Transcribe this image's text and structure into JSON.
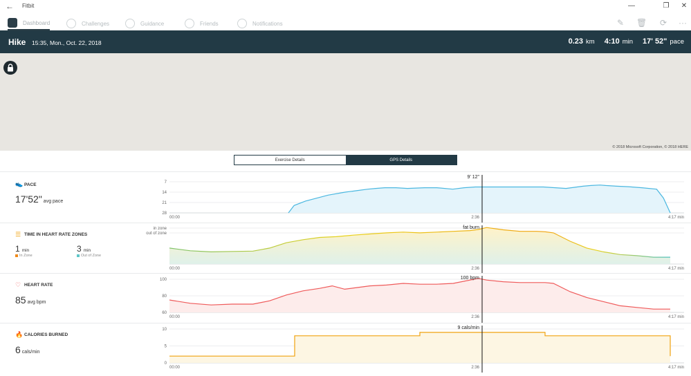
{
  "window": {
    "app_name": "Fitbit",
    "back_glyph": "←",
    "minimize_glyph": "—",
    "restore_glyph": "❐",
    "close_glyph": "✕"
  },
  "nav": {
    "items": [
      {
        "label": "Dashboard",
        "icon": "dashboard-icon",
        "active": true
      },
      {
        "label": "Challenges",
        "icon": "star-badge-icon",
        "active": false
      },
      {
        "label": "Guidance",
        "icon": "compass-icon",
        "active": false
      },
      {
        "label": "Friends",
        "icon": "friends-icon",
        "active": false
      },
      {
        "label": "Notifications",
        "icon": "chat-bubble-icon",
        "active": false
      }
    ],
    "tools": {
      "edit": "✎",
      "delete": "🗑",
      "sync": "⟳",
      "more": "···"
    }
  },
  "header": {
    "activity": "Hike",
    "datetime": "15:35, Mon., Oct. 22, 2018",
    "distance_value": "0.23",
    "distance_unit": "km",
    "duration_value": "4:10",
    "duration_unit": "min",
    "pace_value": "17' 52\"",
    "pace_unit": "pace"
  },
  "map": {
    "copyright": "© 2018 Microsoft Corporation, © 2018 HERE",
    "lock_icon": "lock-icon"
  },
  "tabs": {
    "exercise": "Exercise Details",
    "gps": "GPS Details",
    "selected": "gps"
  },
  "colors": {
    "header_bg": "#223a45",
    "pace": "#4ab7e0",
    "calories": "#f0a20f",
    "heart": "#ef5a5a"
  },
  "sections": {
    "pace": {
      "title": "PACE",
      "value": "17'52\"",
      "unit": "avg pace",
      "icon": "shoe-icon"
    },
    "zones": {
      "title": "TIME IN HEART RATE ZONES",
      "icon": "zone-bars-icon",
      "in_value": "1",
      "in_unit": "min",
      "in_label": "In Zone",
      "out_value": "3",
      "out_unit": "min",
      "out_label": "Out of Zone"
    },
    "heart": {
      "title": "HEART RATE",
      "value": "85",
      "unit": "avg bpm",
      "icon": "heart-icon"
    },
    "calories": {
      "title": "CALORIES BURNED",
      "value": "6",
      "unit": "cals/min",
      "icon": "flame-icon"
    }
  },
  "chart_data": [
    {
      "type": "area",
      "name": "pace",
      "x_ticks": [
        "00:00",
        "2:36",
        "4:17 min"
      ],
      "y_ticks": [
        "7",
        "14",
        "21",
        "28"
      ],
      "ylim": [
        28,
        7
      ],
      "marker_label": "9' 12\"",
      "x": [
        0,
        1.05,
        1.1,
        1.2,
        1.4,
        1.55,
        1.65,
        1.75,
        1.82,
        1.9,
        2.0,
        2.1,
        2.25,
        2.36,
        2.5,
        2.6,
        2.7,
        2.8,
        2.95,
        3.05,
        3.15,
        3.3,
        3.5,
        3.65,
        3.72,
        3.8,
        3.85,
        3.95,
        4.05,
        4.17,
        4.3,
        4.36,
        4.42
      ],
      "y": [
        null,
        28,
        23,
        20,
        16,
        14,
        13,
        12,
        11.5,
        11,
        11,
        11.5,
        11,
        11,
        12,
        11,
        10.5,
        10.5,
        10.5,
        10.5,
        10.5,
        10.5,
        11.5,
        10,
        9.5,
        9.2,
        9.5,
        10,
        10.3,
        11,
        12,
        18,
        28
      ]
    },
    {
      "type": "area",
      "name": "heart_rate_zones",
      "x_ticks": [
        "00:00",
        "2:36",
        "4:17 min"
      ],
      "y_ticks": [
        "in zone",
        "out of zone"
      ],
      "marker_label": "fat burn",
      "x": [
        0,
        0.25,
        0.5,
        0.75,
        1.0,
        1.2,
        1.4,
        1.6,
        1.8,
        2.0,
        2.2,
        2.4,
        2.6,
        2.8,
        3.0,
        3.2,
        3.4,
        3.6,
        3.7,
        3.8,
        4.0,
        4.2,
        4.4,
        4.5,
        4.6,
        4.8,
        5.0,
        5.2,
        5.4,
        5.6,
        5.8,
        6.0
      ],
      "y": [
        0.72,
        0.65,
        0.62,
        0.63,
        0.64,
        0.72,
        0.86,
        0.94,
        1.0,
        1.02,
        1.06,
        1.09,
        1.12,
        1.14,
        1.12,
        1.14,
        1.16,
        1.18,
        1.21,
        1.26,
        1.2,
        1.16,
        1.16,
        1.15,
        1.12,
        0.9,
        0.72,
        0.62,
        0.55,
        0.52,
        0.48,
        0.48
      ]
    },
    {
      "type": "area",
      "name": "heart_rate",
      "x_ticks": [
        "00:00",
        "2:36",
        "4:17 min"
      ],
      "y_ticks": [
        "100",
        "80",
        "60"
      ],
      "ylim": [
        60,
        100
      ],
      "marker_label": "100 bpm",
      "x": [
        0,
        0.25,
        0.5,
        0.75,
        1.0,
        1.2,
        1.4,
        1.6,
        1.8,
        1.95,
        2.1,
        2.25,
        2.4,
        2.6,
        2.8,
        3.0,
        3.2,
        3.4,
        3.55,
        3.7,
        3.8,
        4.0,
        4.2,
        4.4,
        4.5,
        4.6,
        4.8,
        5.0,
        5.2,
        5.4,
        5.6,
        5.8,
        6.0
      ],
      "y": [
        75,
        71,
        69,
        70,
        70,
        74,
        81,
        86,
        89,
        92,
        88,
        90,
        92,
        93,
        95,
        94,
        94,
        95,
        98,
        101,
        99,
        97,
        96,
        96,
        96,
        95,
        85,
        78,
        73,
        68,
        66,
        64,
        64
      ]
    },
    {
      "type": "area",
      "name": "calories",
      "x_ticks": [
        "00:00",
        "2:36",
        "4:17 min"
      ],
      "y_ticks": [
        "10",
        "5",
        "0"
      ],
      "ylim": [
        0,
        10
      ],
      "marker_label": "9 cals/min",
      "x": [
        0,
        1.4,
        1.4,
        2.8,
        2.8,
        4.2,
        4.2,
        5.6,
        5.6
      ],
      "y": [
        2,
        2,
        8,
        8,
        9,
        9,
        8,
        8,
        2
      ]
    }
  ]
}
